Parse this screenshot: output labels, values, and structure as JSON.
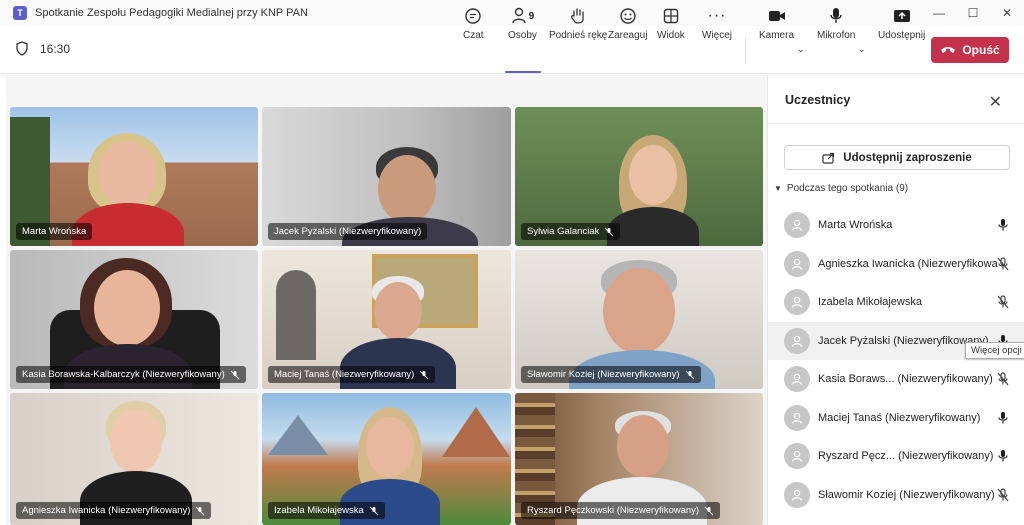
{
  "window": {
    "title": "Spotkanie Zespołu Pedagogiki Medialnej przy KNP PAN",
    "app_icon": "teams-icon"
  },
  "toolbar": {
    "time": "16:30",
    "chat": "Czat",
    "people": "Osoby",
    "people_count": "9",
    "raise_hand": "Podnieś rękę",
    "react": "Zareaguj",
    "view": "Widok",
    "more": "Więcej",
    "camera": "Kamera",
    "mic": "Mikrofon",
    "share": "Udostępnij",
    "leave": "Opuść"
  },
  "tiles": [
    {
      "name": "Marta Wrońska",
      "muted": false
    },
    {
      "name": "Jacek Pyżalski (Niezweryfikowany)",
      "muted": false
    },
    {
      "name": "Sylwia Galanciak",
      "muted": true
    },
    {
      "name": "Kasia Borawska-Kalbarczyk (Niezweryfikowany)",
      "muted": true
    },
    {
      "name": "Maciej Tanaś (Niezweryfikowany)",
      "muted": true
    },
    {
      "name": "Sławomir Koziej (Niezweryfikowany)",
      "muted": true
    },
    {
      "name": "Agnieszka Iwanicka (Niezweryfikowany)",
      "muted": true
    },
    {
      "name": "Izabela Mikołajewska",
      "muted": true
    },
    {
      "name": "Ryszard Pęczkowski (Niezweryfikowany)",
      "muted": true
    }
  ],
  "panel": {
    "title": "Uczestnicy",
    "share_invite": "Udostępnij zaproszenie",
    "group_header": "Podczas tego spotkania (9)",
    "tooltip": "Więcej opcji",
    "participants": [
      {
        "name": "Marta Wrońska",
        "muted": false
      },
      {
        "name": "Agnieszka Iwanicka (Niezweryfikowany)",
        "muted": true
      },
      {
        "name": "Izabela Mikołajewska",
        "muted": true
      },
      {
        "name": "Jacek Pyżalski (Niezweryfikowany)",
        "muted": false
      },
      {
        "name": "Kasia Boraws... (Niezweryfikowany)",
        "muted": true
      },
      {
        "name": "Maciej Tanaś (Niezweryfikowany)",
        "muted": false
      },
      {
        "name": "Ryszard Pęcz... (Niezweryfikowany)",
        "muted": false
      },
      {
        "name": "Sławomir Koziej (Niezweryfikowany)",
        "muted": true
      }
    ]
  },
  "colors": {
    "accent": "#5b5fc7",
    "leave": "#c4314b"
  }
}
